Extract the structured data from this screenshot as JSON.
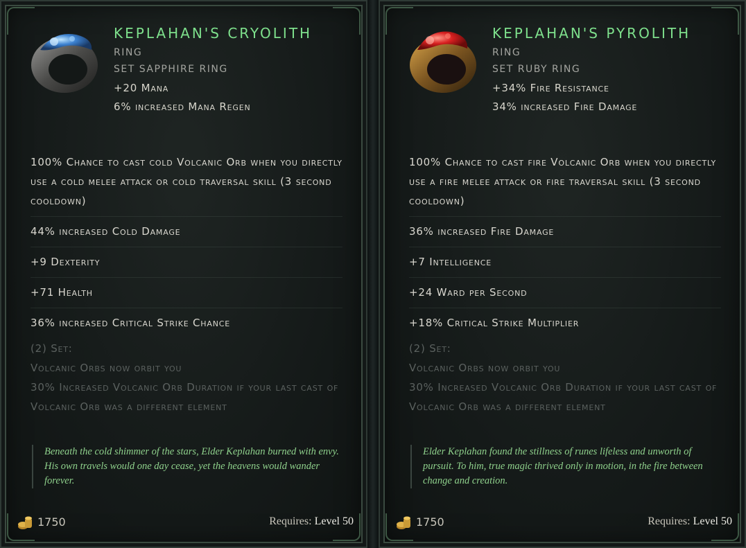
{
  "cards": [
    {
      "name": "Keplahan's Cryolith",
      "type": "Ring",
      "subtype": "Set Sapphire Ring",
      "implicits": [
        "+20 Mana",
        "6% increased Mana Regen"
      ],
      "affixes": [
        "100% Chance to cast cold Volcanic Orb when you directly use a cold melee attack or cold traversal skill (3 second cooldown)",
        "44% increased Cold Damage",
        "+9 Dexterity",
        "+71 Health",
        "36% increased Critical Strike Chance"
      ],
      "set": {
        "header": "(2) Set:",
        "bonus1": "Volcanic Orbs now orbit you",
        "bonus2": "30% Increased Volcanic Orb Duration if your last cast of Volcanic Orb was a different element"
      },
      "lore": "Beneath the cold shimmer of the stars, Elder Keplahan burned with envy. His own travels would one day cease, yet the heavens would wander forever.",
      "gold": "1750",
      "requires_label": "Requires:",
      "requires_value": "Level 50",
      "gem_color": "#4a8fd8"
    },
    {
      "name": "Keplahan's Pyrolith",
      "type": "Ring",
      "subtype": "Set Ruby Ring",
      "implicits": [
        "+34% Fire Resistance",
        "34% increased Fire Damage"
      ],
      "affixes": [
        "100% Chance to cast fire Volcanic Orb when you directly use a fire melee attack or fire traversal skill (3 second cooldown)",
        "36% increased Fire Damage",
        "+7 Intelligence",
        "+24 Ward per Second",
        "+18% Critical Strike Multiplier"
      ],
      "set": {
        "header": "(2) Set:",
        "bonus1": "Volcanic Orbs now orbit you",
        "bonus2": "30% Increased Volcanic Orb Duration if your last cast of Volcanic Orb was a different element"
      },
      "lore": "Elder Keplahan found the stillness of runes lifeless and unworth of pursuit. To him, true magic thrived only in motion, in the fire between change and creation.",
      "gold": "1750",
      "requires_label": "Requires:",
      "requires_value": "Level 50",
      "gem_color": "#d8282a"
    }
  ],
  "colors": {
    "item_name": "#7ee08c",
    "lore": "#8fd18c",
    "set_text": "#5b615f"
  }
}
